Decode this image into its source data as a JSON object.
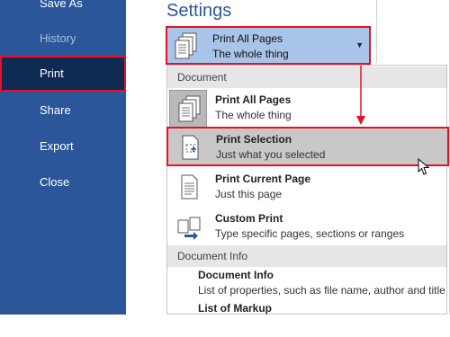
{
  "sidebar": {
    "items": [
      {
        "label": "Save As"
      },
      {
        "label": "History"
      },
      {
        "label": "Print"
      },
      {
        "label": "Share"
      },
      {
        "label": "Export"
      },
      {
        "label": "Close"
      }
    ]
  },
  "settings": {
    "title": "Settings",
    "selected": {
      "label": "Print All Pages",
      "desc": "The whole thing"
    }
  },
  "menu": {
    "groups": [
      {
        "header": "Document",
        "items": [
          {
            "label": "Print All Pages",
            "desc": "The whole thing",
            "icon": "all-pages-icon"
          },
          {
            "label": "Print Selection",
            "desc": "Just what you selected",
            "icon": "selection-icon"
          },
          {
            "label": "Print Current Page",
            "desc": "Just this page",
            "icon": "page-icon"
          },
          {
            "label": "Custom Print",
            "desc": "Type specific pages, sections or ranges",
            "icon": "custom-print-icon"
          }
        ]
      },
      {
        "header": "Document Info",
        "items": [
          {
            "label": "Document Info",
            "desc": "List of properties, such as file name, author and title"
          },
          {
            "label": "List of Markup",
            "desc": ""
          }
        ]
      }
    ]
  },
  "colors": {
    "sidebar": "#2b579a",
    "active": "#0f2a52",
    "highlight": "#e81123"
  }
}
